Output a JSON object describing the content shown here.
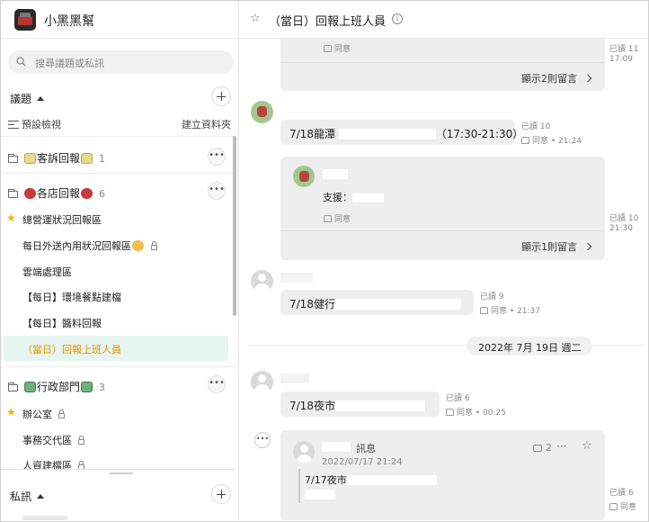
{
  "app": {
    "name": "小黑黑幫"
  },
  "search": {
    "placeholder": "搜尋議題或私訊"
  },
  "topics": {
    "header": "議題",
    "view_label": "預設檢視",
    "new_folder_label": "建立資料夾",
    "folders": [
      {
        "name_prefix": "",
        "name": "客訴回報",
        "count": "1"
      },
      {
        "name": "各店回報",
        "count": "6"
      },
      {
        "name": "行政部門",
        "count": "3"
      }
    ],
    "channels_store": [
      {
        "label": "總營運狀況回報區"
      },
      {
        "label": "每日外送內用狀況回報區"
      },
      {
        "label": "雲端處理區"
      },
      {
        "label": "【每日】環境餐點建檔"
      },
      {
        "label": "【每日】醬料回報"
      },
      {
        "label": "（當日）回報上班人員"
      }
    ],
    "channels_admin": [
      {
        "label": "辦公室"
      },
      {
        "label": "事務交代區"
      },
      {
        "label": "人資建檔區"
      }
    ]
  },
  "dm": {
    "header": "私訊"
  },
  "channel": {
    "title": "（當日）回報上班人員"
  },
  "messages": {
    "m0": {
      "like": "同意",
      "read": "已讀 11",
      "time": "17:09",
      "show_replies": "顯示2則留言"
    },
    "m1": {
      "text_a": "7/18龍潭 ",
      "text_b": "（17:30-21:30）",
      "read": "已讀 10",
      "like": "同意",
      "time": "21:24",
      "reply_text": "支援：",
      "reply_like": "同意",
      "reply_read": "已讀 10",
      "reply_time": "21:30",
      "show_replies": "顯示1則留言"
    },
    "m2": {
      "text": "7/18健行",
      "read": "已讀 9",
      "like": "同意",
      "time": "21:37"
    },
    "date_separator": "2022年 7月 19日 週二",
    "m3": {
      "text": "7/18夜市",
      "read": "已讀 6",
      "like": "同意",
      "time": "00:25"
    },
    "m4": {
      "title_suffix": "訊息",
      "reply_count": "2",
      "date": "2022/07/17 21:24",
      "quote": "7/17夜市",
      "read": "已讀 6",
      "like": "同意"
    }
  },
  "colors": {
    "active_channel_bg": "#e6f5ef",
    "active_channel_text": "#e89400",
    "star": "#f0b400"
  }
}
